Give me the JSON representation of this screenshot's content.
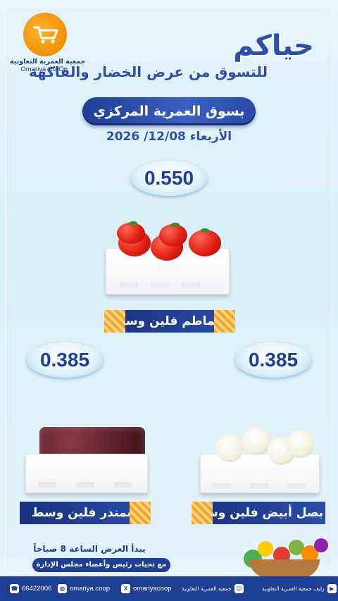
{
  "logo": {
    "name_ar": "جمعية العمرية التعاونية",
    "name_en": "Omariya Co-Op."
  },
  "headline": {
    "greeting": "حياكم",
    "subtitle": "للتسوق من عرض الخضار والفاكهة",
    "market": "بسوق العمرية المركزي",
    "date": "الأربعاء 12/08/ 2026"
  },
  "products": [
    {
      "name": "طماطم فلين وسط",
      "price": "0.550"
    },
    {
      "name": "شمندر فلين وسط",
      "price": "0.385"
    },
    {
      "name": "بصل أبيض فلين وسط",
      "price": "0.385"
    }
  ],
  "notice": {
    "start": "يبدأ العرض الساعة 8 صباحاً",
    "greeting": "مع تحيات رئيس وأعضاء مجلس الإدارة"
  },
  "footer": {
    "phone": "66422006",
    "instagram": "omariya.coop",
    "x": "omariyacoop",
    "snapchat_ar": "جمعية العمرية التعاونية",
    "youtube_ar": "زايف جمعية العمرية التعاونية"
  },
  "colors": {
    "brand_blue": "#1f3f94",
    "accent_orange": "#f39200",
    "background": "#dff1f8"
  }
}
